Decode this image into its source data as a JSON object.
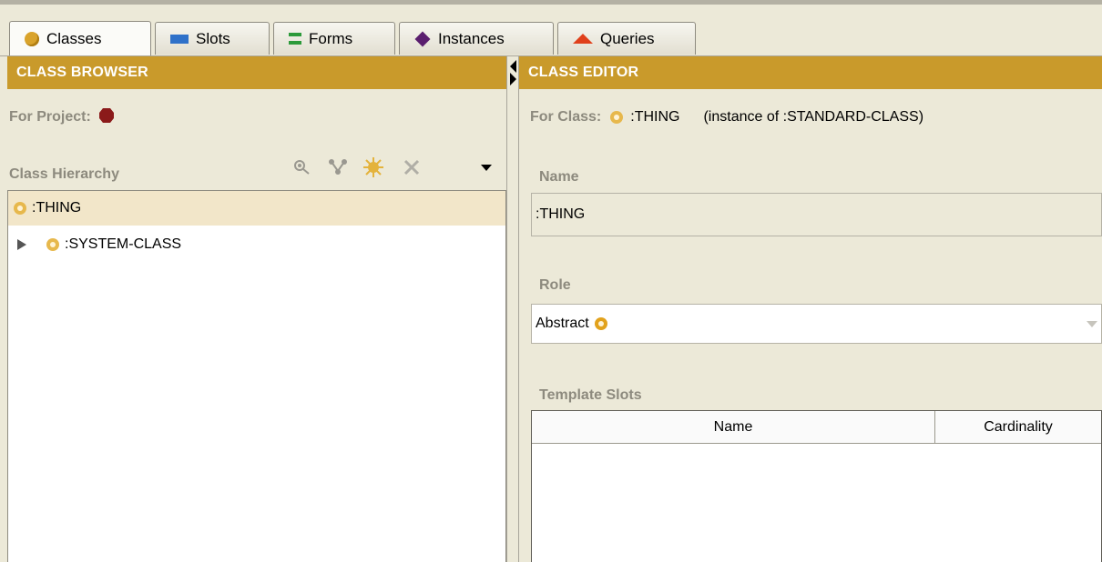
{
  "tabs": [
    {
      "label": "Classes",
      "icon": "classes-icon",
      "active": true
    },
    {
      "label": "Slots",
      "icon": "slots-icon"
    },
    {
      "label": "Forms",
      "icon": "forms-icon"
    },
    {
      "label": "Instances",
      "icon": "instances-icon"
    },
    {
      "label": "Queries",
      "icon": "queries-icon"
    }
  ],
  "browser": {
    "header": "CLASS BROWSER",
    "for_project_label": "For Project:",
    "hierarchy_label": "Class Hierarchy",
    "tree": [
      {
        "label": ":THING",
        "selected": true
      },
      {
        "label": ":SYSTEM-CLASS",
        "expandable": true
      }
    ]
  },
  "editor": {
    "header": "CLASS EDITOR",
    "for_class_label": "For Class:",
    "class_name": ":THING",
    "instance_of": "(instance of :STANDARD-CLASS)",
    "name_label": "Name",
    "name_value": ":THING",
    "role_label": "Role",
    "role_value": "Abstract",
    "template_slots_label": "Template Slots",
    "table_columns": [
      "Name",
      "Cardinality"
    ]
  },
  "colors": {
    "header_bg": "#c99a2b",
    "selection_bg": "#f2e6c9",
    "project_icon": "#8b1a1a"
  }
}
